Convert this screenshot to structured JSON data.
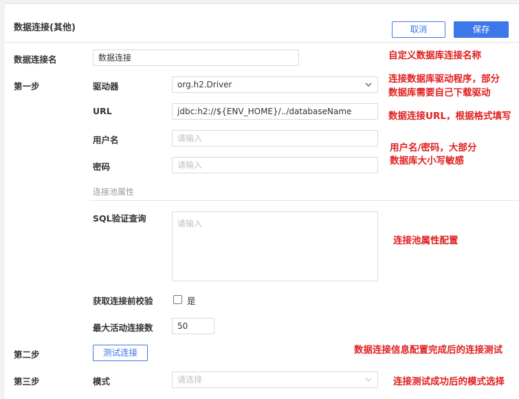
{
  "header": {
    "title": "数据连接(其他)",
    "cancel_label": "取消",
    "save_label": "保存"
  },
  "form": {
    "name_label": "数据连接名",
    "name_value": "数据连接",
    "step1_label": "第一步",
    "driver_label": "驱动器",
    "driver_value": "org.h2.Driver",
    "url_label": "URL",
    "url_value": "jdbc:h2://${ENV_HOME}/../databaseName",
    "username_label": "用户名",
    "username_placeholder": "请输入",
    "password_label": "密码",
    "password_placeholder": "请输入",
    "pool_section_label": "连接池属性",
    "sql_label": "SQL验证查询",
    "sql_placeholder": "请输入",
    "validate_label": "获取连接前校验",
    "validate_option": "是",
    "validate_checked": false,
    "max_active_label": "最大活动连接数",
    "max_active_value": "50",
    "step2_label": "第二步",
    "test_button_label": "测试连接",
    "step3_label": "第三步",
    "mode_label": "模式",
    "mode_placeholder": "请选择"
  },
  "annotations": {
    "name_note": "自定义数据库连接名称",
    "driver_note_line1": "连接数据库驱动程序，部分",
    "driver_note_line2": "数据库需要自己下载驱动",
    "url_note": "数据连接URL，根据格式填写",
    "user_note_line1": "用户名/密码，大部分",
    "user_note_line2": "数据库大小写敏感",
    "pool_note": "连接池属性配置",
    "test_note": "数据连接信息配置完成后的连接测试",
    "mode_note": "连接测试成功后的模式选择"
  },
  "colors": {
    "accent": "#3c78e8",
    "annotation": "#e02020",
    "placeholder": "#c0c0c0"
  },
  "icons": {
    "select_arrow": "chevron-down-icon"
  }
}
